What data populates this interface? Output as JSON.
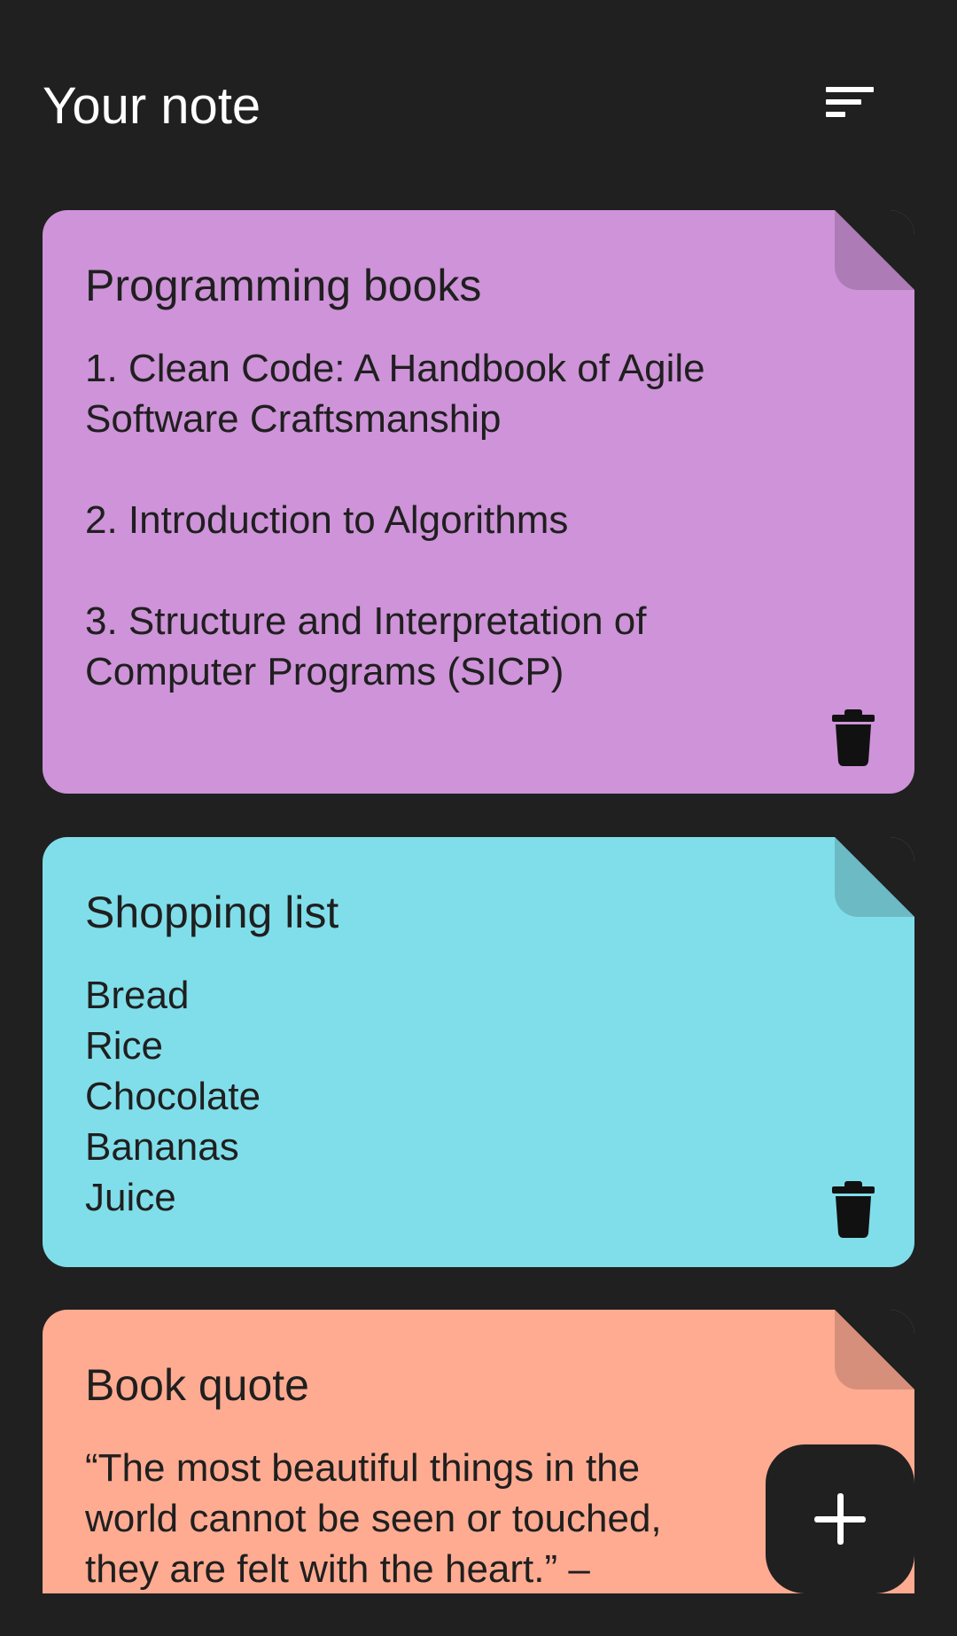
{
  "header": {
    "title": "Your note",
    "sort_icon": "sort-lines-icon"
  },
  "notes": [
    {
      "title": "Programming books",
      "body": "1. Clean Code: A Handbook of Agile\nSoftware Craftsmanship\n\n2. Introduction to Algorithms\n\n3. Structure and Interpretation of\nComputer Programs (SICP)",
      "color": "#CE93D8",
      "fold_color": "#AD7BB5",
      "delete_icon": "trash-icon"
    },
    {
      "title": "Shopping list",
      "body": "Bread\nRice\nChocolate\nBananas\nJuice",
      "color": "#80DEEA",
      "fold_color": "#6BBAC4",
      "delete_icon": "trash-icon"
    },
    {
      "title": "Book quote",
      "body": "“The most beautiful things in the\nworld cannot be seen or touched,\nthey are felt with the heart.” –",
      "color": "#FFAB91",
      "fold_color": "#D68F7A",
      "delete_icon": "trash-icon"
    }
  ],
  "fab": {
    "icon": "plus-icon"
  },
  "colors": {
    "background": "#202020",
    "text": "#1F1F1F",
    "header_text": "#FFFFFF"
  }
}
